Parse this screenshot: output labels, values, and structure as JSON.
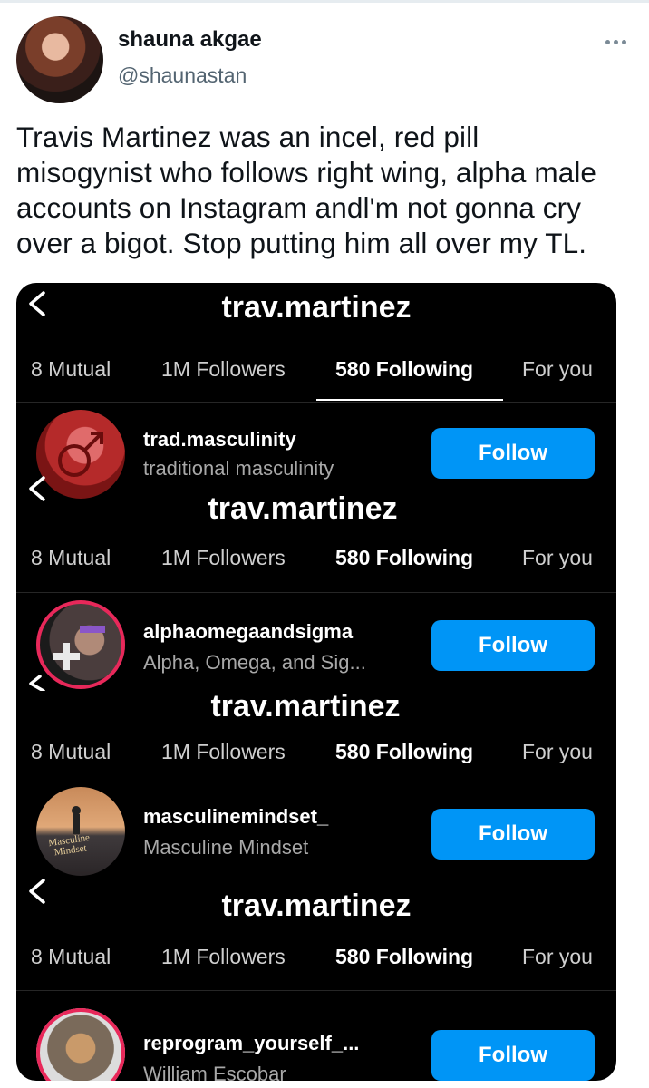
{
  "tweet": {
    "author_name": "shauna akgae",
    "author_handle": "@shaunastan",
    "lines": [
      "Travis Martinez was an incel, red pill",
      "misogynist who follows right wing, alpha male",
      "accounts on Instagram andl'm not gonna cry",
      "over a bigot. Stop putting him all over my TL."
    ]
  },
  "instagram": {
    "profile_title": "trav.martinez",
    "tabs": [
      "8 Mutual",
      "1M Followers",
      "580 Following",
      "For you"
    ],
    "follow_label": "Follow",
    "accounts": [
      {
        "handle": "trad.masculinity",
        "name": "traditional masculinity"
      },
      {
        "handle": "alphaomegaandsigma",
        "name": "Alpha, Omega, and Sig..."
      },
      {
        "handle": "masculinemindset_",
        "name": "Masculine Mindset",
        "avatar_text": "Masculine Mindset"
      },
      {
        "handle": "reprogram_yourself_...",
        "name": "William Escobar"
      }
    ]
  },
  "colors": {
    "follow_button": "#0095f6",
    "story_ring": "#e8285a",
    "handle_grey": "#536471"
  }
}
